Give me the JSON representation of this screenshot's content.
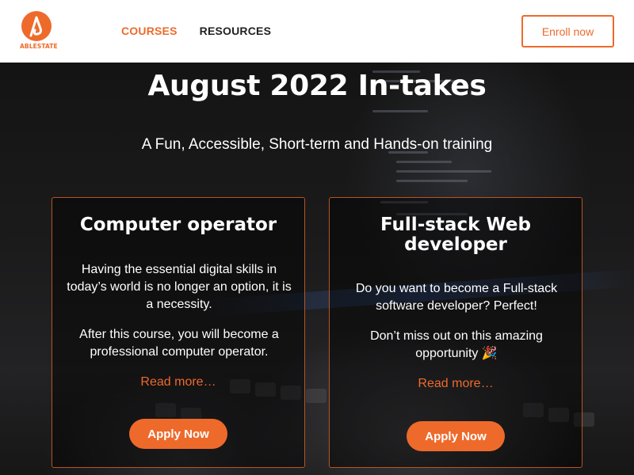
{
  "header": {
    "logo_text": "ABLESTATE",
    "nav": [
      {
        "label": "COURSES",
        "active": true
      },
      {
        "label": "RESOURCES",
        "active": false
      }
    ],
    "enroll_label": "Enroll now"
  },
  "hero": {
    "title": "August 2022 In-takes",
    "subtitle": "A Fun, Accessible, Short-term and Hands-on training"
  },
  "cards": [
    {
      "title": "Computer operator",
      "paragraphs": [
        "Having  the essential digital skills in today’s world is no longer an option, it is a necessity.",
        "After this course, you will become a professional computer operator."
      ],
      "read_more": "Read more…",
      "apply_label": "Apply Now"
    },
    {
      "title": "Full-stack Web developer",
      "paragraphs": [
        "Do you want to become a Full-stack software developer?  Perfect!",
        "Don’t miss out on this amazing opportunity 🎉"
      ],
      "read_more": "Read more…",
      "apply_label": "Apply Now"
    }
  ],
  "colors": {
    "accent": "#ee6a2b",
    "header_bg": "#ffffff",
    "hero_bg": "#141414"
  }
}
